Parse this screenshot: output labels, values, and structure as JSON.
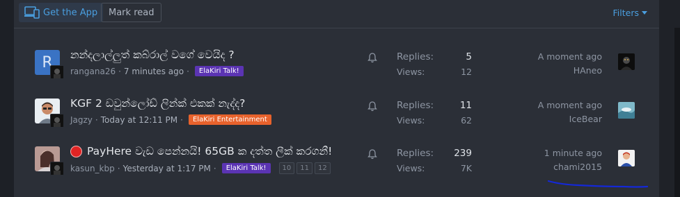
{
  "toolbar": {
    "get_app_label": "Get the App",
    "mark_read_label": "Mark read",
    "filters_label": "Filters"
  },
  "threads": [
    {
      "avatar_letter": "R",
      "title": "නන්දලාල්ලුත් කබ්රාල් වගේ වෙයිද ?",
      "author": "rangana26",
      "time": "7 minutes ago",
      "tag": "ElaKiri Talk!",
      "replies_label": "Replies:",
      "replies": "5",
      "views_label": "Views:",
      "views": "12",
      "last_time": "A moment ago",
      "last_user": "HAneo"
    },
    {
      "title": "KGF 2 ඩවුන්ලෝඩ් ලින්ක් එකක් නැද්ද?",
      "author": "Jagzy",
      "time": "Today at 12:11 PM",
      "tag": "ElaKiri Entertainment",
      "replies_label": "Replies:",
      "replies": "11",
      "views_label": "Views:",
      "views": "62",
      "last_time": "A moment ago",
      "last_user": "IceBear"
    },
    {
      "title": "PayHere වැඩ පෙන්නයි! 65GB ක දත්ත ලීක් කරගනී!",
      "author": "kasun_kbp",
      "time": "Yesterday at 1:17 PM",
      "tag": "ElaKiri Talk!",
      "pages": [
        "10",
        "11",
        "12"
      ],
      "replies_label": "Replies:",
      "replies": "239",
      "views_label": "Views:",
      "views": "7K",
      "last_time": "1 minute ago",
      "last_user": "chami2015"
    }
  ],
  "colors": {
    "accent": "#4a9fe0",
    "tag_purple": "#5b34b3",
    "tag_orange": "#e8622c",
    "hot_dot": "#e02424"
  },
  "icons": {
    "app": "devices-icon",
    "filters": "caret-down-icon",
    "watch": "bell-icon",
    "hot": "red-circle-icon"
  }
}
